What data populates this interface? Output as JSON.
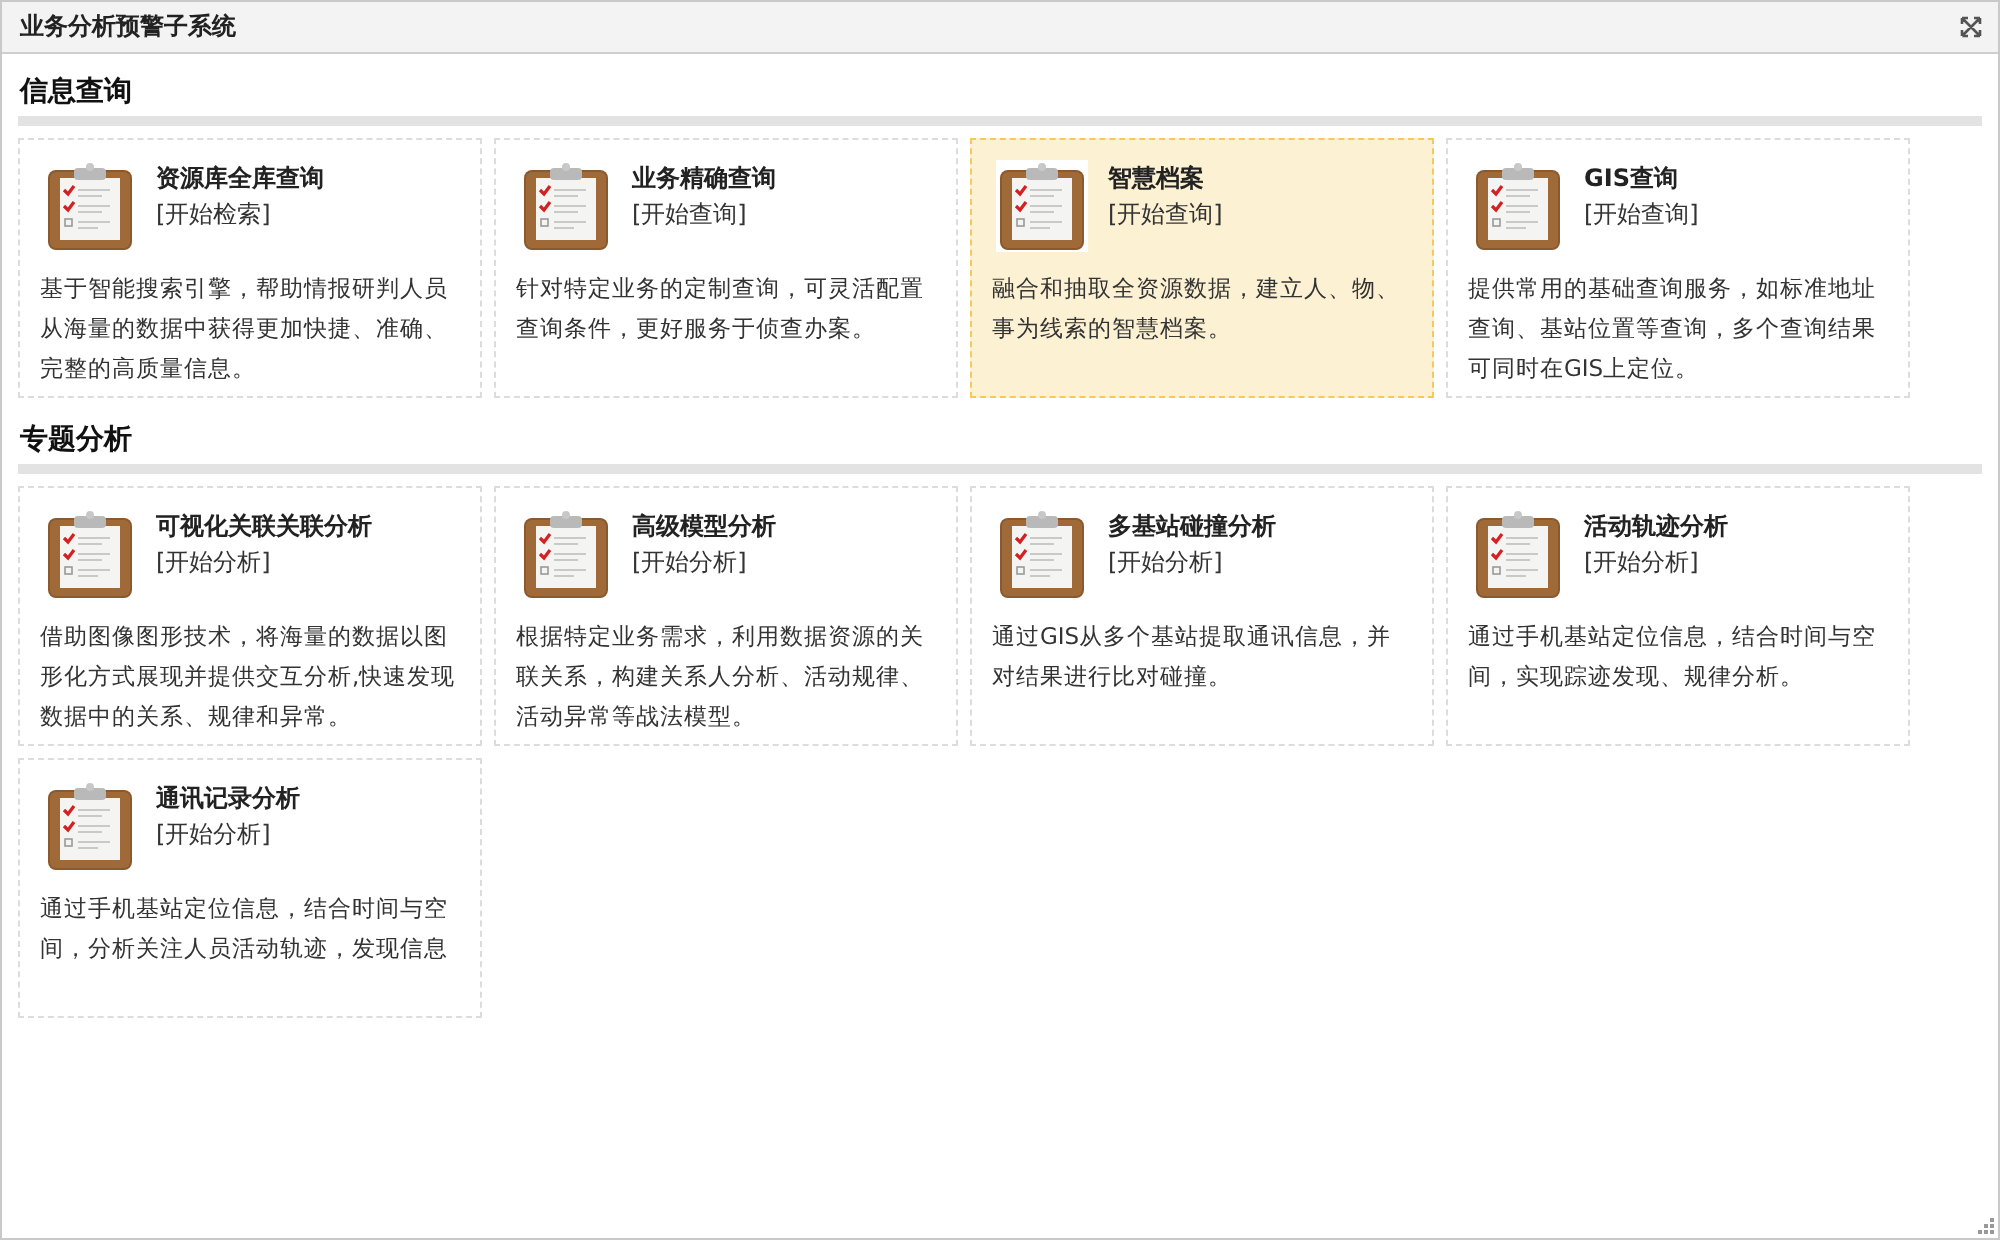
{
  "window": {
    "title": "业务分析预警子系统"
  },
  "sections": [
    {
      "heading": "信息查询",
      "cards": [
        {
          "title": "资源库全库查询",
          "link": "[开始检索]",
          "description": "基于智能搜索引擎，帮助情报研判人员从海量的数据中获得更加快捷、准确、完整的高质量信息。",
          "selected": false
        },
        {
          "title": "业务精确查询",
          "link": "[开始查询]",
          "description": "针对特定业务的定制查询，可灵活配置查询条件，更好服务于侦查办案。",
          "selected": false
        },
        {
          "title": "智慧档案",
          "link": "[开始查询]",
          "description": "融合和抽取全资源数据，建立人、物、事为线索的智慧档案。",
          "selected": true
        },
        {
          "title": "GIS查询",
          "link": "[开始查询]",
          "description": "提供常用的基础查询服务，如标准地址查询、基站位置等查询，多个查询结果可同时在GIS上定位。",
          "selected": false
        }
      ]
    },
    {
      "heading": "专题分析",
      "cards": [
        {
          "title": "可视化关联关联分析",
          "link": "[开始分析]",
          "description": "借助图像图形技术，将海量的数据以图形化方式展现并提供交互分析,快速发现数据中的关系、规律和异常。",
          "selected": false
        },
        {
          "title": "高级模型分析",
          "link": "[开始分析]",
          "description": "根据特定业务需求，利用数据资源的关联关系，构建关系人分析、活动规律、活动异常等战法模型。",
          "selected": false
        },
        {
          "title": "多基站碰撞分析",
          "link": "[开始分析]",
          "description": "通过GIS从多个基站提取通讯信息，并对结果进行比对碰撞。",
          "selected": false
        },
        {
          "title": "活动轨迹分析",
          "link": "[开始分析]",
          "description": "通过手机基站定位信息，结合时间与空间，实现踪迹发现、规律分析。",
          "selected": false
        },
        {
          "title": "通讯记录分析",
          "link": "[开始分析]",
          "description": "通过手机基站定位信息，结合时间与空间，分析关注人员活动轨迹，发现信息",
          "selected": false
        }
      ]
    }
  ]
}
